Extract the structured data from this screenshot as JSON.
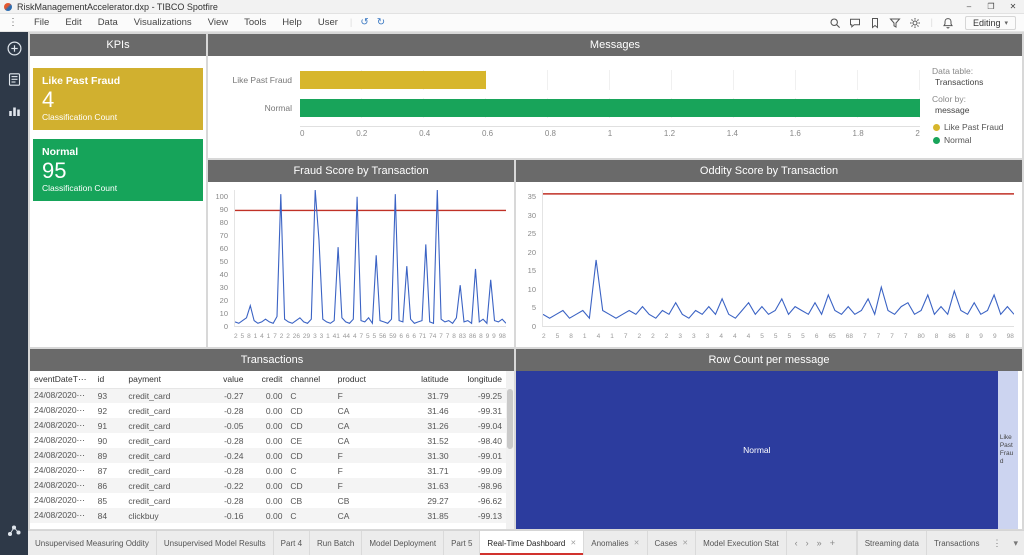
{
  "window": {
    "title": "RiskManagementAccelerator.dxp - TIBCO Spotfire",
    "controls": {
      "minimize": "–",
      "maximize": "❐",
      "close": "✕"
    }
  },
  "menubar": {
    "menus": [
      "File",
      "Edit",
      "Data",
      "Visualizations",
      "View",
      "Tools",
      "Help",
      "User"
    ],
    "icons": {
      "kebab": "⋮",
      "undo": "↺",
      "redo": "↻",
      "chevron": "▾"
    },
    "right_icons": [
      "search",
      "comment",
      "bookmark",
      "filter",
      "settings",
      "bell"
    ],
    "editing_label": "Editing"
  },
  "sidebar": {
    "icons": [
      "add-circle",
      "data-list",
      "chart-types",
      "data-canvas"
    ]
  },
  "panels": {
    "kpis": {
      "title": "KPIs",
      "cards": [
        {
          "label": "Like Past Fraud",
          "value": "4",
          "sub": "Classification Count",
          "color": "#d1b02f"
        },
        {
          "label": "Normal",
          "value": "95",
          "sub": "Classification Count",
          "color": "#16a45a"
        }
      ]
    },
    "messages": {
      "title": "Messages",
      "side": {
        "data_table_label": "Data table:",
        "data_table_value": "Transactions",
        "color_by_label": "Color by:",
        "color_by_value": "message",
        "legend": [
          {
            "label": "Like Past Fraud",
            "color": "#d7b62c"
          },
          {
            "label": "Normal",
            "color": "#18a45a"
          }
        ]
      }
    },
    "fraud": {
      "title": "Fraud Score by Transaction"
    },
    "oddity": {
      "title": "Oddity Score by Transaction"
    },
    "transactions": {
      "title": "Transactions",
      "columns": [
        "eventDateT⋯",
        "id",
        "payment",
        "value",
        "credit",
        "channel",
        "product",
        "latitude",
        "longitude"
      ],
      "rows": [
        [
          "24/08/2020⋯",
          "93",
          "credit_card",
          "-0.27",
          "0.00",
          "C",
          "F",
          "31.79",
          "-99.25"
        ],
        [
          "24/08/2020⋯",
          "92",
          "credit_card",
          "-0.28",
          "0.00",
          "CD",
          "CA",
          "31.46",
          "-99.31"
        ],
        [
          "24/08/2020⋯",
          "91",
          "credit_card",
          "-0.05",
          "0.00",
          "CD",
          "CA",
          "31.26",
          "-99.04"
        ],
        [
          "24/08/2020⋯",
          "90",
          "credit_card",
          "-0.28",
          "0.00",
          "CE",
          "CA",
          "31.52",
          "-98.40"
        ],
        [
          "24/08/2020⋯",
          "89",
          "credit_card",
          "-0.24",
          "0.00",
          "CD",
          "F",
          "31.30",
          "-99.01"
        ],
        [
          "24/08/2020⋯",
          "87",
          "credit_card",
          "-0.28",
          "0.00",
          "C",
          "F",
          "31.71",
          "-99.09"
        ],
        [
          "24/08/2020⋯",
          "86",
          "credit_card",
          "-0.22",
          "0.00",
          "CD",
          "F",
          "31.63",
          "-98.96"
        ],
        [
          "24/08/2020⋯",
          "85",
          "credit_card",
          "-0.28",
          "0.00",
          "CB",
          "CB",
          "29.27",
          "-96.62"
        ],
        [
          "24/08/2020⋯",
          "84",
          "clickbuy",
          "-0.16",
          "0.00",
          "C",
          "CA",
          "31.85",
          "-99.13"
        ]
      ]
    },
    "rowcount": {
      "title": "Row Count per message"
    }
  },
  "chart_data": [
    {
      "id": "messages",
      "type": "bar",
      "orientation": "horizontal",
      "title": "Messages",
      "categories": [
        "Like Past Fraud",
        "Normal"
      ],
      "values": [
        0.6,
        2.0
      ],
      "colors": [
        "#d7b62c",
        "#18a45a"
      ],
      "xlim": [
        0,
        2
      ],
      "xticks": [
        "0",
        "0.2",
        "0.4",
        "0.6",
        "0.8",
        "1",
        "1.2",
        "1.4",
        "1.6",
        "1.8",
        "2"
      ]
    },
    {
      "id": "fraud",
      "type": "line",
      "title": "Fraud Score by Transaction",
      "ylim": [
        0,
        100
      ],
      "yticks": [
        100,
        90,
        80,
        70,
        60,
        50,
        40,
        30,
        20,
        10,
        0
      ],
      "ref_line": 85,
      "line_color": "#3b63c4",
      "ref_color": "#c03126",
      "x_tick_labels": [
        "2",
        "5",
        "8",
        "1",
        "4",
        "1",
        "7",
        "2",
        "2",
        "26",
        "29",
        "3",
        "3",
        "1",
        "41",
        "44",
        "4",
        "7",
        "5",
        "5",
        "56",
        "59",
        "6",
        "6",
        "6",
        "71",
        "74",
        "7",
        "7",
        "8",
        "83",
        "86",
        "8",
        "9",
        "9",
        "98"
      ],
      "values": [
        3,
        2,
        4,
        6,
        15,
        4,
        2,
        3,
        5,
        3,
        2,
        7,
        97,
        5,
        3,
        2,
        4,
        6,
        3,
        2,
        5,
        100,
        63,
        5,
        3,
        2,
        4,
        58,
        6,
        3,
        2,
        5,
        95,
        4,
        3,
        6,
        2,
        52,
        4,
        3,
        2,
        5,
        97,
        4,
        3,
        44,
        5,
        2,
        3,
        4,
        60,
        3,
        2,
        100,
        5,
        3,
        4,
        2,
        6,
        30,
        3,
        4,
        2,
        42,
        3,
        5,
        2,
        34,
        4,
        3,
        5,
        2
      ]
    },
    {
      "id": "oddity",
      "type": "line",
      "title": "Oddity Score by Transaction",
      "ylim": [
        0,
        35
      ],
      "yticks": [
        35,
        30,
        25,
        20,
        15,
        10,
        5,
        0
      ],
      "ref_line": 34,
      "line_color": "#3b63c4",
      "ref_color": "#c03126",
      "x_tick_labels": [
        "2",
        "5",
        "8",
        "1",
        "4",
        "1",
        "7",
        "2",
        "2",
        "2",
        "3",
        "3",
        "3",
        "4",
        "4",
        "4",
        "5",
        "5",
        "5",
        "5",
        "6",
        "65",
        "68",
        "7",
        "7",
        "7",
        "7",
        "80",
        "8",
        "86",
        "8",
        "9",
        "9",
        "98"
      ],
      "values": [
        3,
        2,
        3,
        4,
        2,
        3,
        4,
        2,
        17,
        4,
        3,
        2,
        3,
        4,
        3,
        5,
        3,
        2,
        4,
        3,
        6,
        3,
        2,
        4,
        3,
        5,
        3,
        7,
        3,
        2,
        4,
        6,
        3,
        5,
        3,
        4,
        7,
        3,
        5,
        4,
        3,
        6,
        3,
        8,
        4,
        3,
        5,
        3,
        4,
        7,
        3,
        10,
        4,
        3,
        5,
        6,
        3,
        4,
        8,
        3,
        5,
        3,
        9,
        4,
        3,
        6,
        3,
        4,
        8,
        3,
        5,
        3
      ]
    },
    {
      "id": "rowcount",
      "type": "treemap",
      "title": "Row Count per message",
      "segments": [
        {
          "label": "Normal",
          "value": 95,
          "color": "#2c3c9e",
          "text_color": "#ffffff"
        },
        {
          "label": "Like Past Fraud",
          "value": 4,
          "color": "#ccd4f0",
          "text_color": "#444444"
        }
      ]
    }
  ],
  "tabbar": {
    "tabs": [
      {
        "label": "Unsupervised Measuring Oddity",
        "active": false,
        "closable": false
      },
      {
        "label": "Unsupervised Model Results",
        "active": false,
        "closable": false
      },
      {
        "label": "Part 4",
        "active": false,
        "closable": false
      },
      {
        "label": "Run Batch",
        "active": false,
        "closable": false
      },
      {
        "label": "Model Deployment",
        "active": false,
        "closable": false
      },
      {
        "label": "Part 5",
        "active": false,
        "closable": false
      },
      {
        "label": "Real-Time Dashboard",
        "active": true,
        "closable": true
      },
      {
        "label": "Anomalies",
        "active": false,
        "closable": true
      },
      {
        "label": "Cases",
        "active": false,
        "closable": true
      },
      {
        "label": "Model Execution Stat",
        "active": false,
        "closable": false
      }
    ],
    "nav": [
      "‹",
      "›",
      "»",
      "+"
    ],
    "right_tabs": [
      "Streaming data",
      "Transactions"
    ],
    "kebab": "⋮",
    "chevron": "▾",
    "close_glyph": "✕"
  }
}
